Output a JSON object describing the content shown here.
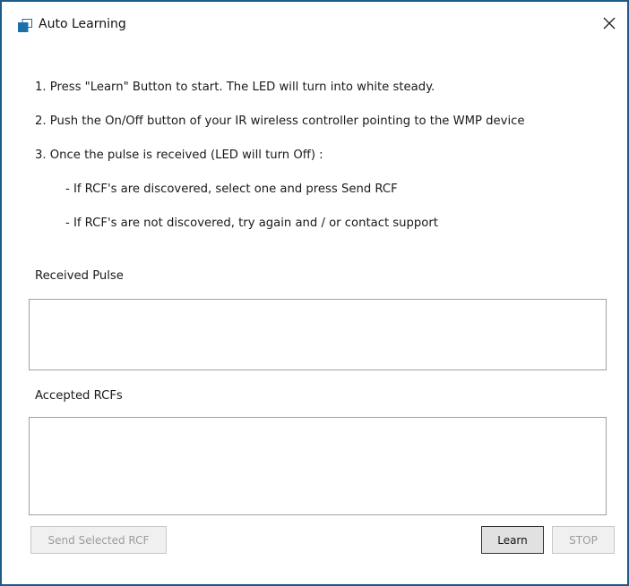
{
  "window": {
    "title": "Auto Learning",
    "close_glyph": "✕",
    "accent": "#1e5a86"
  },
  "instructions": [
    "1. Press \"Learn\" Button to start. The LED will turn into white steady.",
    "2. Push the On/Off button of your IR wireless controller pointing to the WMP device",
    "3. Once the pulse is received (LED will turn Off) :",
    "- If RCF's are discovered, select one and press Send RCF",
    "- If RCF's are not discovered, try again and / or contact support"
  ],
  "received_pulse": {
    "label": "Received Pulse",
    "value": ""
  },
  "accepted_rcfs": {
    "label": "Accepted RCFs",
    "items": []
  },
  "buttons": {
    "send_selected": {
      "label": "Send Selected RCF",
      "enabled": false
    },
    "learn": {
      "label": "Learn",
      "enabled": true
    },
    "stop": {
      "label": "STOP",
      "enabled": false
    }
  },
  "icons": {
    "app": "app-window-icon",
    "close": "close-icon"
  }
}
